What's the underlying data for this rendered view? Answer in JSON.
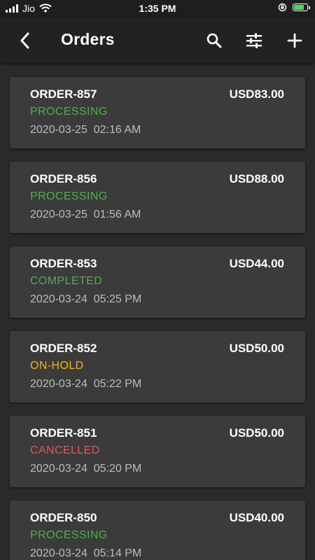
{
  "status_bar": {
    "carrier": "Jio",
    "time": "1:35 PM"
  },
  "header": {
    "title": "Orders",
    "icons": [
      "back-arrow-icon",
      "search-icon",
      "filter-icon",
      "plus-icon"
    ]
  },
  "colors": {
    "processing": "#4caf50",
    "completed": "#4caf50",
    "on_hold": "#f5b800",
    "cancelled": "#ef5350"
  },
  "orders": [
    {
      "id": "ORDER-857",
      "amount": "USD83.00",
      "status": "PROCESSING",
      "status_key": "processing",
      "date": "2020-03-25",
      "time": "02:16 AM"
    },
    {
      "id": "ORDER-856",
      "amount": "USD88.00",
      "status": "PROCESSING",
      "status_key": "processing",
      "date": "2020-03-25",
      "time": "01:56 AM"
    },
    {
      "id": "ORDER-853",
      "amount": "USD44.00",
      "status": "COMPLETED",
      "status_key": "completed",
      "date": "2020-03-24",
      "time": "05:25 PM"
    },
    {
      "id": "ORDER-852",
      "amount": "USD50.00",
      "status": "ON-HOLD",
      "status_key": "on_hold",
      "date": "2020-03-24",
      "time": "05:22 PM"
    },
    {
      "id": "ORDER-851",
      "amount": "USD50.00",
      "status": "CANCELLED",
      "status_key": "cancelled",
      "date": "2020-03-24",
      "time": "05:20 PM"
    },
    {
      "id": "ORDER-850",
      "amount": "USD40.00",
      "status": "PROCESSING",
      "status_key": "processing",
      "date": "2020-03-24",
      "time": "05:14 PM"
    }
  ]
}
